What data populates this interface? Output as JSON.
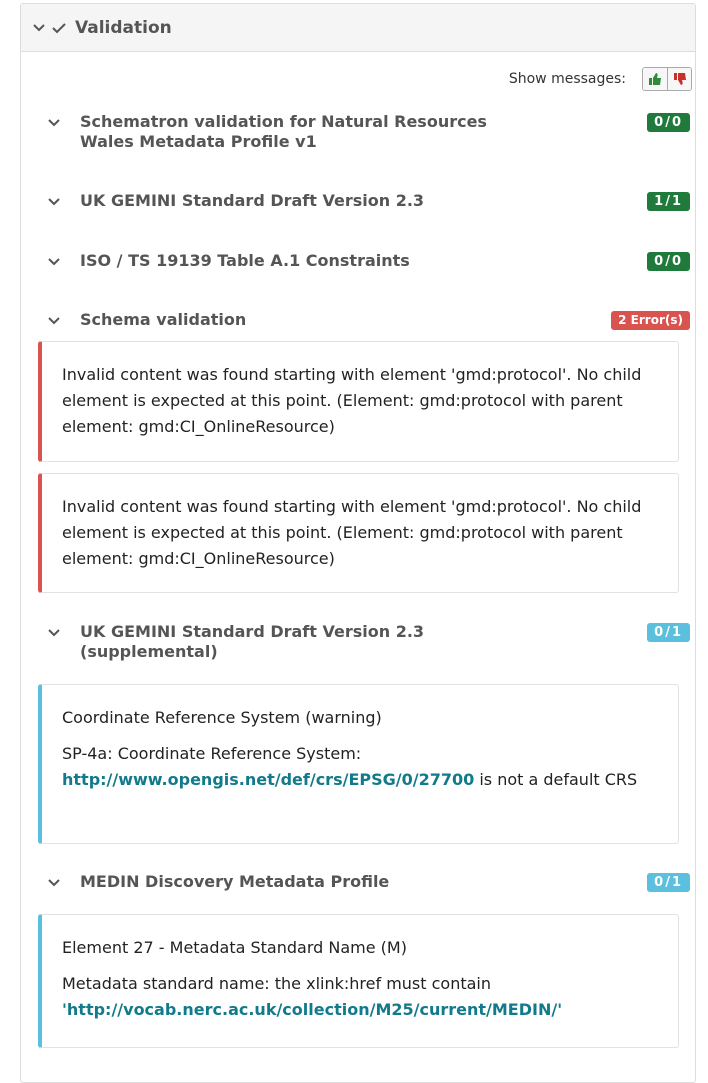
{
  "panel": {
    "title": "Validation"
  },
  "show_messages": {
    "label": "Show messages:"
  },
  "sections": [
    {
      "title_line1": "Schematron validation for Natural Resources",
      "title_line2": "Wales Metadata Profile v1",
      "badge": "0/0"
    },
    {
      "title_line1": "UK GEMINI Standard Draft Version 2.3",
      "badge": "1/1"
    },
    {
      "title_line1": "ISO / TS 19139 Table A.1 Constraints",
      "badge": "0/0"
    },
    {
      "title_line1": "Schema validation",
      "badge": "2 Error(s)"
    },
    {
      "title_line1": "UK GEMINI Standard Draft Version 2.3",
      "title_line2": "(supplemental)",
      "badge": "0/1"
    },
    {
      "title_line1": "MEDIN Discovery Metadata Profile",
      "badge": "0/1"
    }
  ],
  "messages": {
    "schema_error_1": "Invalid content was found starting with element 'gmd:protocol'. No child element is expected at this point. (Element: gmd:protocol with parent element: gmd:CI_OnlineResource)",
    "schema_error_2": "Invalid content was found starting with element 'gmd:protocol'. No child element is expected at this point. (Element: gmd:protocol with parent element: gmd:CI_OnlineResource)",
    "crs_title": "Coordinate Reference System (warning)",
    "crs_prefix": "SP-4a: Coordinate Reference System:",
    "crs_link": "http://www.opengis.net/def/crs/EPSG/0/27700",
    "crs_suffix": " is not a default CRS",
    "medin_title": "Element 27 - Metadata Standard Name (M)",
    "medin_prefix": "Metadata standard name: the xlink:href must contain",
    "medin_quote_open": "'",
    "medin_link": "http://vocab.nerc.ac.uk/collection/M25/current/MEDIN/",
    "medin_quote_close": "'"
  },
  "colors": {
    "success": "#1f7a3c",
    "danger": "#d9534f",
    "info": "#5bc0de",
    "link": "#117a8b"
  },
  "icons": {
    "collapse": "chevron-down-icon",
    "check": "check-icon",
    "thumbs_up": "thumbs-up-icon",
    "thumbs_down": "thumbs-down-icon"
  }
}
